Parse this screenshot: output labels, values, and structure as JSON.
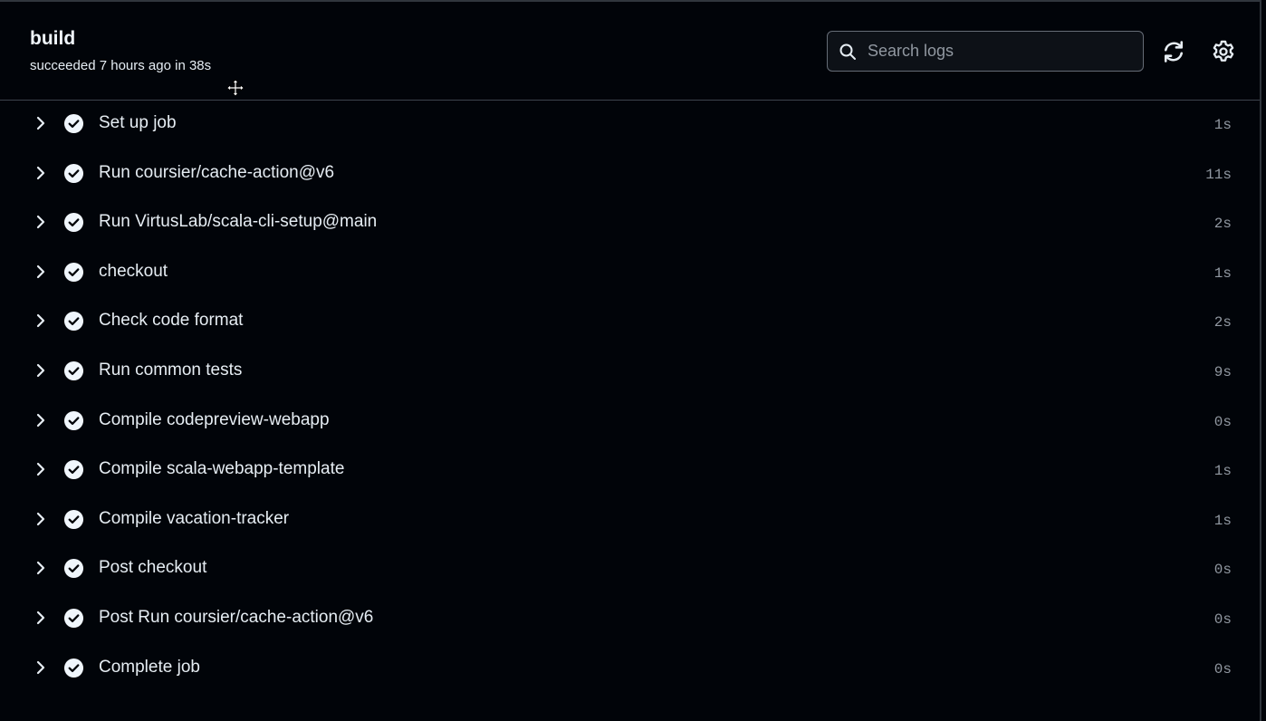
{
  "job": {
    "title": "build",
    "status": "succeeded 7 hours ago in 38s"
  },
  "search": {
    "placeholder": "Search logs",
    "value": ""
  },
  "toolbar": {
    "refresh_icon": "refresh-icon",
    "settings_icon": "gear-icon"
  },
  "steps": [
    {
      "name": "Set up job",
      "duration": "1s"
    },
    {
      "name": "Run coursier/cache-action@v6",
      "duration": "11s"
    },
    {
      "name": "Run VirtusLab/scala-cli-setup@main",
      "duration": "2s"
    },
    {
      "name": "checkout",
      "duration": "1s"
    },
    {
      "name": "Check code format",
      "duration": "2s"
    },
    {
      "name": "Run common tests",
      "duration": "9s"
    },
    {
      "name": "Compile codepreview-webapp",
      "duration": "0s"
    },
    {
      "name": "Compile scala-webapp-template",
      "duration": "1s"
    },
    {
      "name": "Compile vacation-tracker",
      "duration": "1s"
    },
    {
      "name": "Post checkout",
      "duration": "0s"
    },
    {
      "name": "Post Run coursier/cache-action@v6",
      "duration": "0s"
    },
    {
      "name": "Complete job",
      "duration": "0s"
    }
  ],
  "colors": {
    "background": "#010409",
    "text": "#e6edf3",
    "muted": "#9198a1",
    "border": "#3d444d",
    "success_icon": "#f0f6fc"
  }
}
